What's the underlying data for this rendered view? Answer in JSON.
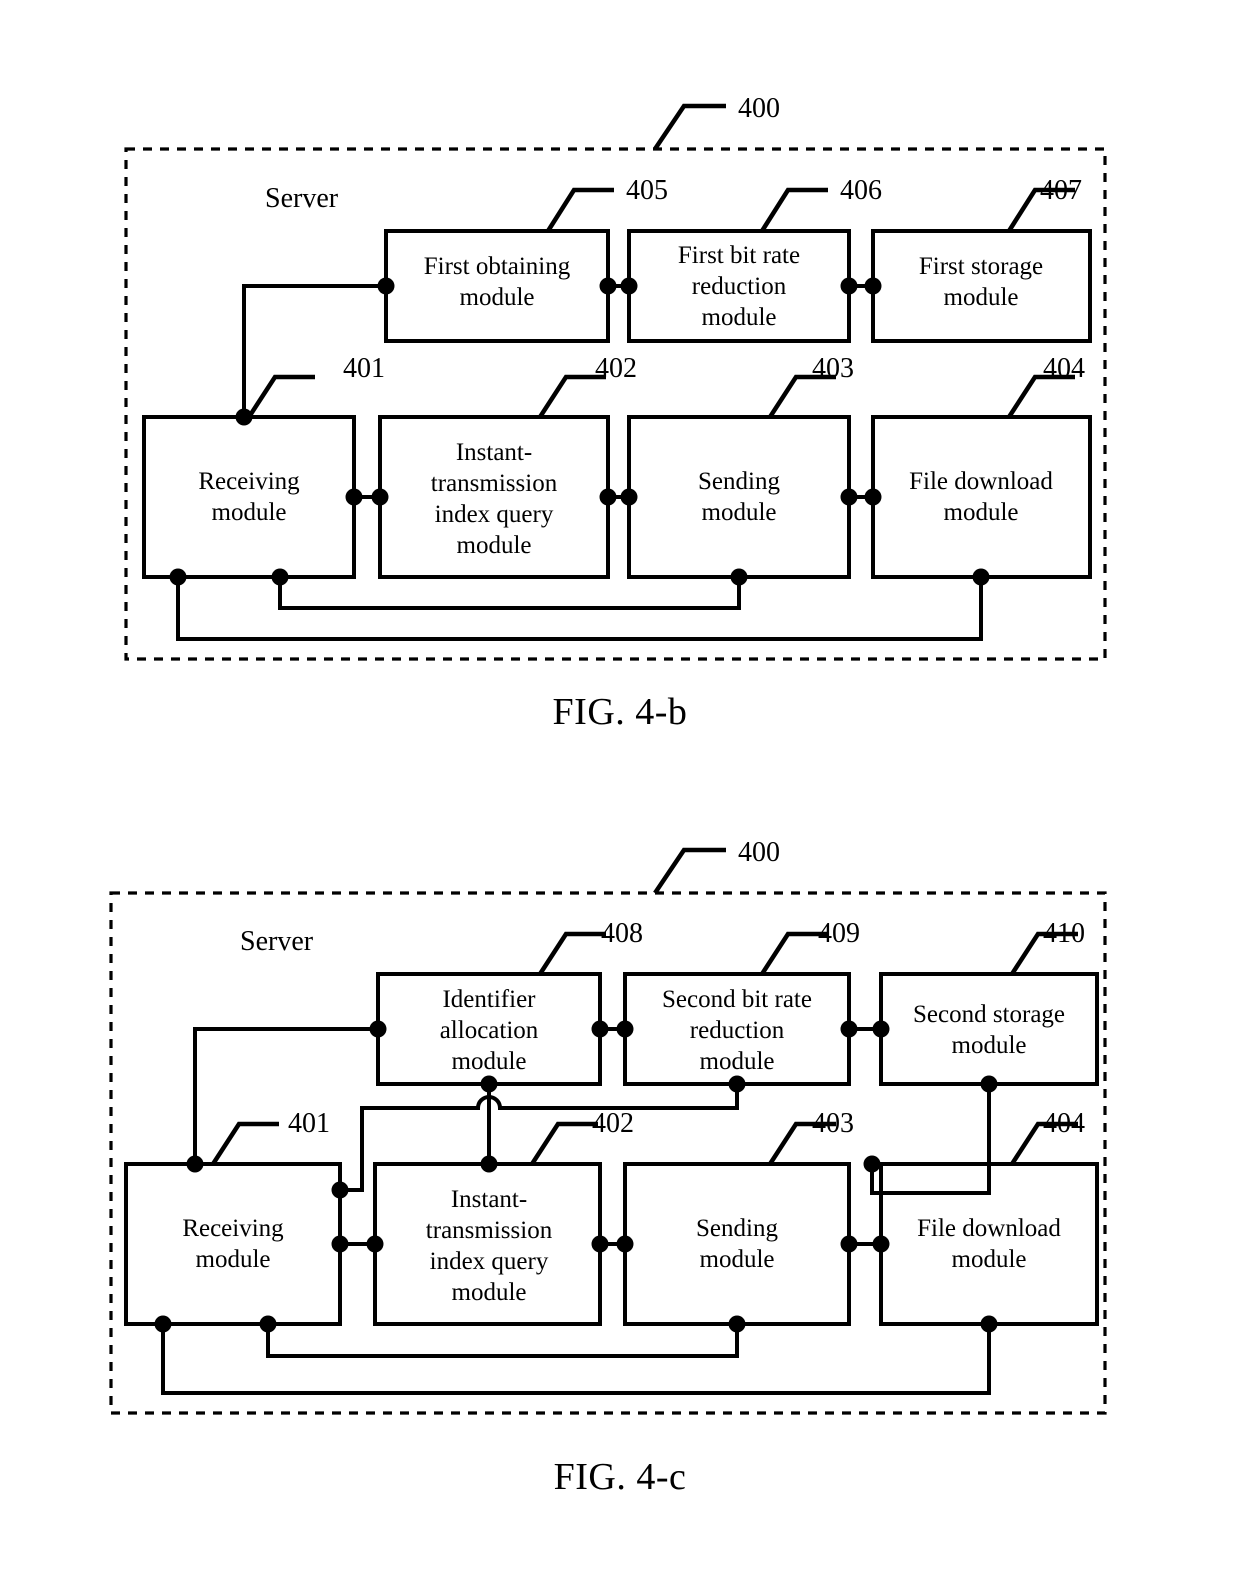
{
  "document": {
    "type": "patent-figure-sheet",
    "figure_count": 2
  },
  "figures": [
    {
      "id": "fig-4b",
      "caption": "FIG. 4-b",
      "container_label": "Server",
      "container_ref": "400",
      "modules": [
        {
          "ref": "405",
          "label_lines": [
            "First obtaining",
            "module"
          ]
        },
        {
          "ref": "406",
          "label_lines": [
            "First bit rate",
            "reduction",
            "module"
          ]
        },
        {
          "ref": "407",
          "label_lines": [
            "First storage",
            "module"
          ]
        },
        {
          "ref": "401",
          "label_lines": [
            "Receiving",
            "module"
          ]
        },
        {
          "ref": "402",
          "label_lines": [
            "Instant-",
            "transmission",
            "index query",
            "module"
          ]
        },
        {
          "ref": "403",
          "label_lines": [
            "Sending",
            "module"
          ]
        },
        {
          "ref": "404",
          "label_lines": [
            "File download",
            "module"
          ]
        }
      ]
    },
    {
      "id": "fig-4c",
      "caption": "FIG. 4-c",
      "container_label": "Server",
      "container_ref": "400",
      "modules": [
        {
          "ref": "408",
          "label_lines": [
            "Identifier",
            "allocation",
            "module"
          ]
        },
        {
          "ref": "409",
          "label_lines": [
            "Second bit rate",
            "reduction",
            "module"
          ]
        },
        {
          "ref": "410",
          "label_lines": [
            "Second storage",
            "module"
          ]
        },
        {
          "ref": "401",
          "label_lines": [
            "Receiving",
            "module"
          ]
        },
        {
          "ref": "402",
          "label_lines": [
            "Instant-",
            "transmission",
            "index query",
            "module"
          ]
        },
        {
          "ref": "403",
          "label_lines": [
            "Sending",
            "module"
          ]
        },
        {
          "ref": "404",
          "label_lines": [
            "File download",
            "module"
          ]
        }
      ]
    }
  ],
  "colors": {
    "ink": "#000000",
    "paper": "#ffffff"
  }
}
